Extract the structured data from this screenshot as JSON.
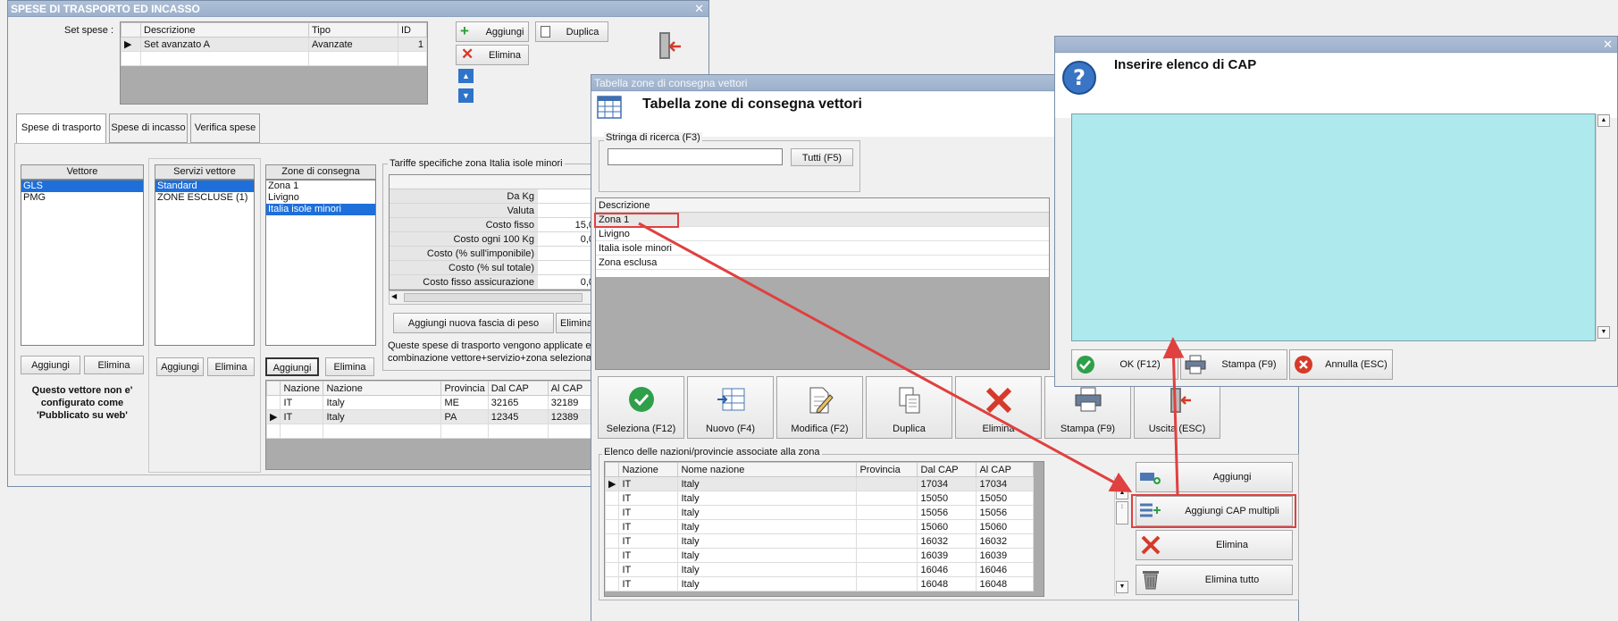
{
  "win1": {
    "title": "SPESE DI TRASPORTO ED INCASSO",
    "set_label": "Set spese :",
    "set_table": {
      "headers": [
        "Descrizione",
        "Tipo",
        "ID"
      ],
      "rows": [
        [
          "Set avanzato A",
          "Avanzate",
          "1"
        ]
      ]
    },
    "btn_aggiungi": "Aggiungi",
    "btn_duplica": "Duplica",
    "btn_elimina": "Elimina",
    "tabs": [
      "Spese di trasporto",
      "Spese di incasso",
      "Verifica spese"
    ],
    "vettore_head": "Vettore",
    "vettori": [
      "GLS",
      "PMG"
    ],
    "servizi_head": "Servizi vettore",
    "servizi": [
      "Standard",
      "ZONE ESCLUSE (1)"
    ],
    "zone_head": "Zone di consegna",
    "zone": [
      "Zona 1",
      "Livigno",
      "Italia isole minori"
    ],
    "tariffe_title": "Tariffe specifiche zona Italia isole minori",
    "tariffe_rows": [
      {
        "label": "Da Kg",
        "value": ""
      },
      {
        "label": "Valuta",
        "value": ""
      },
      {
        "label": "Costo fisso",
        "value": "15,0"
      },
      {
        "label": "Costo ogni 100 Kg",
        "value": "0,0"
      },
      {
        "label": "Costo (% sull'imponibile)",
        "value": ""
      },
      {
        "label": "Costo (% sul totale)",
        "value": ""
      },
      {
        "label": "Costo fisso assicurazione",
        "value": "0,0"
      }
    ],
    "btn_fascia": "Aggiungi nuova fascia di peso",
    "btn_elimina_short": "Elimina",
    "note_line1": "Queste spese di trasporto vengono applicate e",
    "note_line2": "combinazione vettore+servizio+zona selezionat",
    "warn_lines": [
      "Questo vettore non e'",
      "configurato come",
      "'Pubblicato su web'"
    ],
    "cap_table": {
      "headers": [
        "Nazione",
        "Nazione",
        "Provincia",
        "Dal CAP",
        "Al CAP"
      ],
      "rows": [
        [
          "IT",
          "Italy",
          "ME",
          "32165",
          "32189"
        ],
        [
          "IT",
          "Italy",
          "PA",
          "12345",
          "12389"
        ]
      ]
    }
  },
  "win2": {
    "title": "Tabella zone di consegna vettori",
    "heading": "Tabella zone di consegna vettori",
    "search_legend": "Stringa di ricerca (F3)",
    "search_value": "",
    "btn_tutti": "Tutti (F5)",
    "list_header": "Descrizione",
    "zone": [
      "Zona 1",
      "Livigno",
      "Italia isole minori",
      "Zona esclusa"
    ],
    "buttons": [
      "Seleziona (F12)",
      "Nuovo (F4)",
      "Modifica (F2)",
      "Duplica",
      "Elimina",
      "Stampa (F9)",
      "Uscita (ESC)"
    ],
    "elenco_legend": "Elenco delle nazioni/provincie associate alla zona",
    "elenco_headers": [
      "Nazione",
      "Nome nazione",
      "Provincia",
      "Dal CAP",
      "Al CAP"
    ],
    "elenco_rows": [
      [
        "IT",
        "Italy",
        "",
        "17034",
        "17034"
      ],
      [
        "IT",
        "Italy",
        "",
        "15050",
        "15050"
      ],
      [
        "IT",
        "Italy",
        "",
        "15056",
        "15056"
      ],
      [
        "IT",
        "Italy",
        "",
        "15060",
        "15060"
      ],
      [
        "IT",
        "Italy",
        "",
        "16032",
        "16032"
      ],
      [
        "IT",
        "Italy",
        "",
        "16039",
        "16039"
      ],
      [
        "IT",
        "Italy",
        "",
        "16046",
        "16046"
      ],
      [
        "IT",
        "Italy",
        "",
        "16048",
        "16048"
      ]
    ],
    "side_buttons": [
      "Aggiungi",
      "Aggiungi CAP multipli",
      "Elimina",
      "Elimina tutto"
    ]
  },
  "win3": {
    "heading": "Inserire elenco di CAP",
    "textarea_value": "",
    "buttons": [
      "OK (F12)",
      "Stampa (F9)",
      "Annulla (ESC)"
    ]
  },
  "colors": {
    "selection": "#1e6fd9",
    "annotation_red": "#e04040",
    "textarea_bg": "#aee9ee",
    "titlebar": "#9db1cc"
  }
}
